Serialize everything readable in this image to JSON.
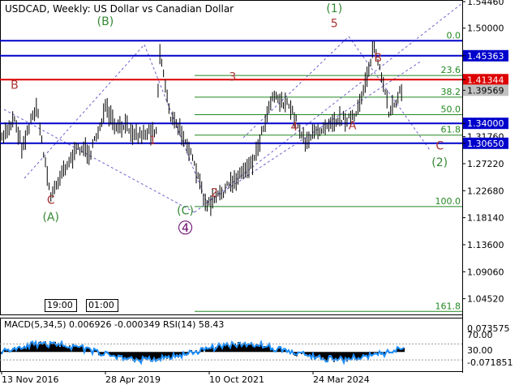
{
  "header": {
    "symbol": "USDCAD",
    "timeframe": "Weekly",
    "description": "US Dollar vs Canadian Dollar"
  },
  "colors": {
    "candle": "#000000",
    "level_blue": "#0000cc",
    "level_red": "#dd0000",
    "fib": "#228822",
    "wave_green": "#338833",
    "wave_red": "#aa3333",
    "wave_purple": "#660066",
    "channel": "#7060c8",
    "macd_hist": "#000000",
    "rsi_line": "#1e90ff",
    "price_box_blue": "#0000cc",
    "price_box_red": "#dd0000",
    "price_box_gray": "#c0c0c0"
  },
  "time_buttons": [
    "19:00",
    "01:00"
  ],
  "chart_data": [
    {
      "type": "line",
      "title": "USDCAD, Weekly: US Dollar vs Canadian Dollar",
      "ylim": [
        1.0188,
        1.5446
      ],
      "y_tick_labels": [
        "1.54460",
        "1.50000",
        "1.45363",
        "1.41344",
        "1.39569",
        "1.34000",
        "1.31760",
        "1.30650",
        "1.27220",
        "1.22680",
        "1.18140",
        "1.13600",
        "1.09060",
        "1.04520"
      ],
      "x_tick_labels": [
        "13 Nov 2016",
        "28 Apr 2019",
        "10 Oct 2021",
        "24 Mar 2024"
      ],
      "current_price": 1.39569,
      "horizontal_levels": [
        {
          "value": 1.47886,
          "label": "1.47886",
          "color": "blue"
        },
        {
          "value": 1.45363,
          "label": "1.45363",
          "color": "blue"
        },
        {
          "value": 1.41344,
          "label": "1.41344",
          "color": "red"
        },
        {
          "value": 1.34,
          "label": "1.34000",
          "color": "blue"
        },
        {
          "value": 1.3065,
          "label": "1.30650",
          "color": "blue"
        }
      ],
      "fibonacci_levels": [
        {
          "label": "0.0",
          "value": 1.47886
        },
        {
          "label": "23.6",
          "value": 1.42044
        },
        {
          "label": "38.2",
          "value": 1.384
        },
        {
          "label": "50.0",
          "value": 1.3546
        },
        {
          "label": "61.8",
          "value": 1.3202
        },
        {
          "label": "100.0",
          "value": 1.2001
        },
        {
          "label": "161.8",
          "value": 1.0239
        }
      ],
      "wave_labels": [
        {
          "text": "B",
          "x": "2016-11",
          "y": 1.398,
          "color": "red"
        },
        {
          "text": "C",
          "x": "2017-09",
          "y": 1.205,
          "color": "red"
        },
        {
          "text": "(A)",
          "x": "2017-09",
          "y": 1.176,
          "color": "green"
        },
        {
          "text": "(B)",
          "x": "2018-12",
          "y": 1.505,
          "color": "green"
        },
        {
          "text": "1",
          "x": "2020-01",
          "y": 1.305,
          "color": "red"
        },
        {
          "text": "(C)",
          "x": "2020-10",
          "y": 1.187,
          "color": "green"
        },
        {
          "text": "4",
          "x": "2020-10",
          "y": 1.158,
          "color": "purple"
        },
        {
          "text": "2",
          "x": "2021-06",
          "y": 1.217,
          "color": "red"
        },
        {
          "text": "3",
          "x": "2021-11",
          "y": 1.412,
          "color": "red"
        },
        {
          "text": "4",
          "x": "2023-04",
          "y": 1.328,
          "color": "red"
        },
        {
          "text": "(1)",
          "x": "2024-03",
          "y": 1.527,
          "color": "green"
        },
        {
          "text": "5",
          "x": "2024-03",
          "y": 1.502,
          "color": "red"
        },
        {
          "text": "A",
          "x": "2024-08",
          "y": 1.33,
          "color": "red"
        },
        {
          "text": "B",
          "x": "2025-03",
          "y": 1.444,
          "color": "red"
        },
        {
          "text": "C",
          "x": "2026-08",
          "y": 1.296,
          "color": "red"
        },
        {
          "text": "(2)",
          "x": "2026-08",
          "y": 1.268,
          "color": "green"
        }
      ],
      "price_path": [
        [
          "2016-07",
          1.31
        ],
        [
          "2016-11",
          1.35
        ],
        [
          "2017-01",
          1.3
        ],
        [
          "2017-05",
          1.37
        ],
        [
          "2017-09",
          1.215
        ],
        [
          "2017-12",
          1.26
        ],
        [
          "2018-05",
          1.3
        ],
        [
          "2018-08",
          1.29
        ],
        [
          "2018-12",
          1.365
        ],
        [
          "2019-03",
          1.33
        ],
        [
          "2019-06",
          1.335
        ],
        [
          "2019-09",
          1.32
        ],
        [
          "2020-02",
          1.33
        ],
        [
          "2020-03",
          1.46
        ],
        [
          "2020-06",
          1.35
        ],
        [
          "2020-10",
          1.315
        ],
        [
          "2021-04",
          1.2
        ],
        [
          "2021-10",
          1.235
        ],
        [
          "2022-05",
          1.28
        ],
        [
          "2022-10",
          1.39
        ],
        [
          "2023-03",
          1.365
        ],
        [
          "2023-07",
          1.31
        ],
        [
          "2024-02",
          1.345
        ],
        [
          "2024-09",
          1.35
        ],
        [
          "2025-02",
          1.47
        ],
        [
          "2025-06",
          1.36
        ],
        [
          "2025-10",
          1.4
        ]
      ]
    },
    {
      "type": "line",
      "title": "MACD(5,34,5) 0.006926 -0.000349 RSI(14) 58.43",
      "ylim": [
        -0.071851,
        0.073575
      ],
      "y_tick_labels": [
        "0.073575",
        "70.00",
        "30.00",
        "-0.071851"
      ],
      "series": [
        {
          "name": "MACD(5,34,5)",
          "values": [
            0.006926,
            -0.000349
          ]
        },
        {
          "name": "RSI(14)",
          "values": [
            58.43
          ]
        }
      ]
    }
  ]
}
